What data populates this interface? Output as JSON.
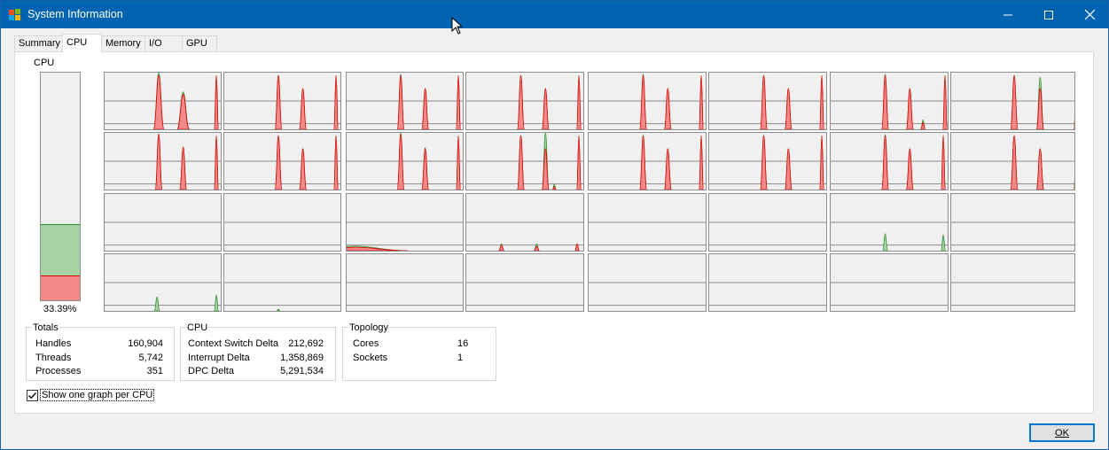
{
  "window": {
    "title": "System Information",
    "accent": "#0063b1"
  },
  "title_buttons": {
    "minimize": "minimize-icon",
    "maximize": "maximize-icon",
    "close": "close-icon"
  },
  "tabs": [
    {
      "label": "Summary"
    },
    {
      "label": "CPU"
    },
    {
      "label": "Memory"
    },
    {
      "label": "I/O"
    },
    {
      "label": "GPU"
    }
  ],
  "active_tab": "CPU",
  "cpu_meter": {
    "label": "CPU",
    "percent_text": "33.39%",
    "total_fraction": 0.3339,
    "kernel_fraction": 0.11,
    "colors": {
      "total_fill": "#a5d3a5",
      "total_line": "#2e8b2e",
      "kernel_fill": "#f4898a",
      "kernel_line": "#e00000"
    }
  },
  "per_cpu_graphs": {
    "count": 32,
    "columns": 8,
    "rows": 4,
    "colors": {
      "total_fill": "#a5d3a5",
      "total_line": "#2e8b2e",
      "kernel_fill": "#f4898a",
      "kernel_line": "#e00000",
      "grid": "#8d8d8d"
    }
  },
  "totals": {
    "title": "Totals",
    "rows": [
      {
        "label": "Handles",
        "value": "160,904"
      },
      {
        "label": "Threads",
        "value": "5,742"
      },
      {
        "label": "Processes",
        "value": "351"
      }
    ]
  },
  "cpu_stats": {
    "title": "CPU",
    "rows": [
      {
        "label": "Context Switch Delta",
        "value": "212,692"
      },
      {
        "label": "Interrupt Delta",
        "value": "1,358,869"
      },
      {
        "label": "DPC Delta",
        "value": "5,291,534"
      }
    ]
  },
  "topology": {
    "title": "Topology",
    "rows": [
      {
        "label": "Cores",
        "value": "16"
      },
      {
        "label": "Sockets",
        "value": "1"
      }
    ]
  },
  "options": {
    "show_one_graph_per_cpu_label": "Show one graph per CPU",
    "show_one_graph_per_cpu_checked": true
  },
  "ok_button": {
    "label": "OK"
  }
}
